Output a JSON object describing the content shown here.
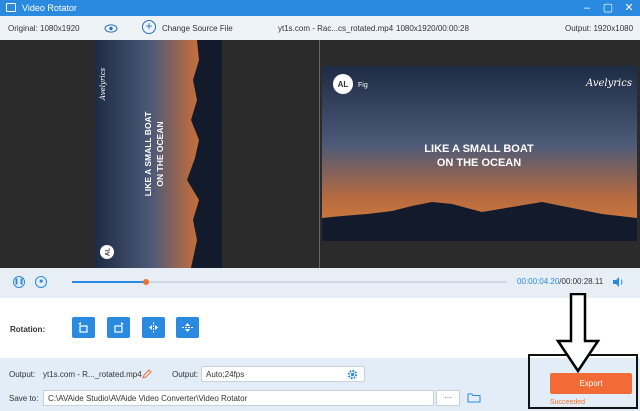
{
  "window": {
    "title": "Video Rotator"
  },
  "infobar": {
    "original": "Original: 1080x1920",
    "change_source": "Change Source File",
    "filename": "yt1s.com - Rac...cs_rotated.mp4",
    "meta": "1080x1920/00:00:28",
    "output": "Output: 1920x1080"
  },
  "video": {
    "lyric_line1": "LIKE A SMALL BOAT",
    "lyric_line2": "ON THE OCEAN",
    "logo": "AL",
    "logo_sub": "Fig",
    "watermark": "Avelyrics"
  },
  "playback": {
    "current_time": "00:00:04.20",
    "total_time": "/00:00:28.11",
    "progress": 0.17
  },
  "rotation": {
    "label": "Rotation:"
  },
  "output": {
    "label": "Output:",
    "filename": "yt1s.com - R..._rotated.mp4",
    "format_label": "Output:",
    "format_value": "Auto;24fps"
  },
  "save": {
    "label": "Save to:",
    "path": "C:\\AVAide Studio\\AVAide Video Converter\\Video Rotator",
    "browse": "···"
  },
  "export": {
    "label": "Export",
    "status": "Succeeded"
  },
  "colors": {
    "accent": "#2a8ae0",
    "export": "#f26a35"
  }
}
